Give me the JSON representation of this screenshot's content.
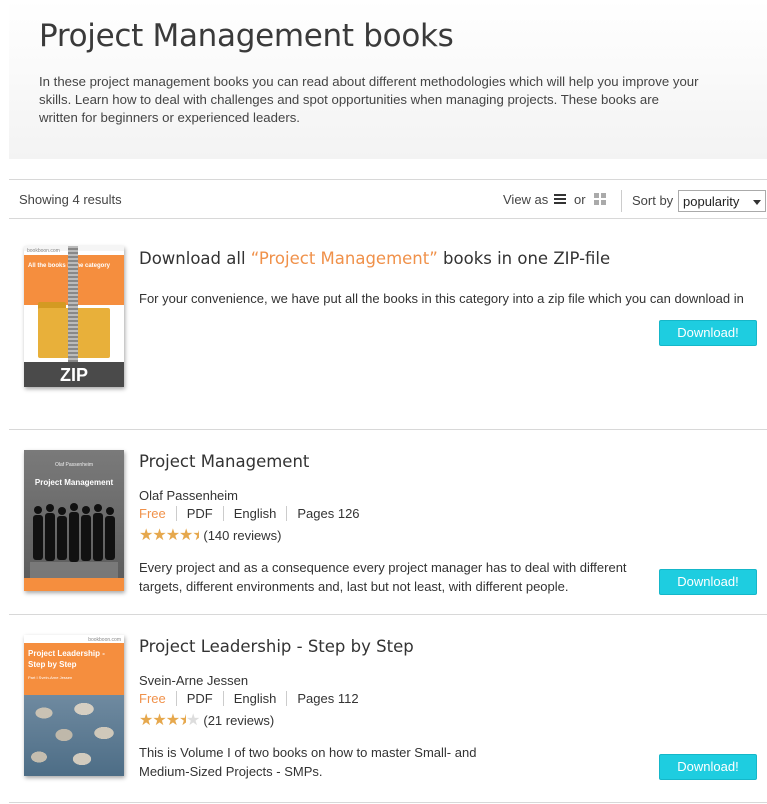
{
  "hero": {
    "title": "Project Management books",
    "description": "In these project management books you can read about different methodologies which will help you improve your skills. Learn how to deal with challenges and spot opportunities when managing projects. These books are written for beginners or experienced leaders."
  },
  "toolbar": {
    "results_text": "Showing 4 results",
    "view_as_label": "View as",
    "or_label": "or",
    "sort_by_label": "Sort by",
    "sort_value": "popularity"
  },
  "zip_item": {
    "title_prefix": "Download all ",
    "title_highlight": "“Project Management”",
    "title_suffix": " books in one ZIP-file",
    "description": "For your convenience, we have put all the books in this category into a zip file which you can download in",
    "button_label": "Download!",
    "cover": {
      "brand": "bookboon.com",
      "orange_text": "All the books in the category",
      "zip_label": "ZIP"
    }
  },
  "books": [
    {
      "title": "Project Management",
      "author": "Olaf Passenheim",
      "price": "Free",
      "format": "PDF",
      "language": "English",
      "pages": "Pages 126",
      "rating": 4.5,
      "reviews": "(140 reviews)",
      "description": "Every project and as a consequence every project manager has to deal with different targets, different environments and, last but not least, with different people.",
      "button_label": "Download!",
      "cover": {
        "author": "Olaf Passenheim",
        "title": "Project Management"
      }
    },
    {
      "title": "Project Leadership - Step by Step",
      "author": "Svein-Arne Jessen",
      "price": "Free",
      "format": "PDF",
      "language": "English",
      "pages": "Pages 112",
      "rating": 3.5,
      "reviews": "(21 reviews)",
      "description": "This is Volume I of two books on how to master Small- and Medium-Sized Projects - SMPs.",
      "button_label": "Download!",
      "cover": {
        "brand": "bookboon.com",
        "title": "Project Leadership - Step by Step",
        "subtitle": "Part I  Svein-Arne Jessen"
      }
    }
  ],
  "colors": {
    "accent_orange": "#f0914a",
    "button_cyan": "#1ecde0",
    "star_gold": "#e6a84d"
  }
}
